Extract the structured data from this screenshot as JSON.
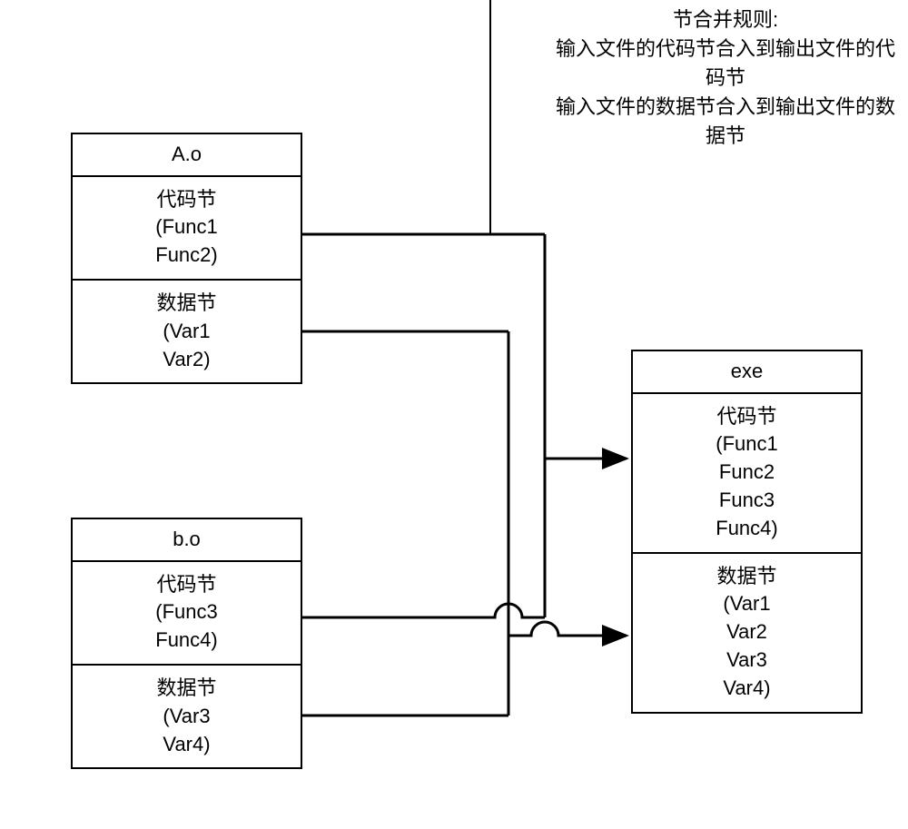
{
  "rules": {
    "title": "节合并规则:",
    "line1": "输入文件的代码节合入到输出文件的代码节",
    "line2": "输入文件的数据节合入到输出文件的数据节"
  },
  "fileA": {
    "name": "A.o",
    "code_label": "代码节",
    "code_items": "(Func1\nFunc2)",
    "data_label": "数据节",
    "data_items": "(Var1\nVar2)"
  },
  "fileB": {
    "name": "b.o",
    "code_label": "代码节",
    "code_items": "(Func3\nFunc4)",
    "data_label": "数据节",
    "data_items": "(Var3\nVar4)"
  },
  "exe": {
    "name": "exe",
    "code_label": "代码节",
    "code_items": "(Func1\nFunc2\nFunc3\nFunc4)",
    "data_label": "数据节",
    "data_items": "(Var1\nVar2\nVar3\nVar4)"
  }
}
